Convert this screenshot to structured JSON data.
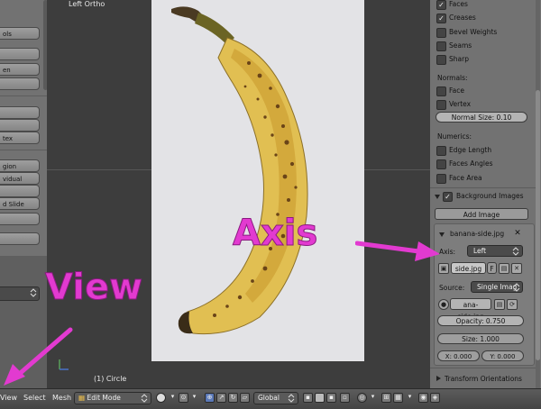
{
  "viewport": {
    "title": "Left Ortho",
    "object_label": "(1) Circle"
  },
  "left_panel": {
    "buttons": [
      "ols",
      "",
      "en",
      "",
      "",
      "tex",
      "gion",
      "vidual",
      "",
      "d Slide",
      "",
      ""
    ]
  },
  "right_panel": {
    "display_checks": [
      {
        "label": "Faces",
        "checked": true
      },
      {
        "label": "Creases",
        "checked": true
      },
      {
        "label": "Bevel Weights",
        "checked": false
      },
      {
        "label": "Seams",
        "checked": false
      },
      {
        "label": "Sharp",
        "checked": false
      }
    ],
    "normals_heading": "Normals:",
    "normals_checks": [
      {
        "label": "Face",
        "checked": false
      },
      {
        "label": "Vertex",
        "checked": false
      }
    ],
    "normal_size": "Normal Size: 0.10",
    "numerics_heading": "Numerics:",
    "numerics_checks": [
      {
        "label": "Edge Length",
        "checked": false
      },
      {
        "label": "Faces Angles",
        "checked": false
      },
      {
        "label": "Face Area",
        "checked": false
      }
    ],
    "background_images": {
      "section_label": "Background Images",
      "enabled": true,
      "add_image_label": "Add Image",
      "image_name": "banana-side.jpg",
      "axis_label": "Axis:",
      "axis_value": "Left",
      "file_field": "side.jpg",
      "file_flag": "F",
      "source_label": "Source:",
      "source_value": "Single Imag",
      "source_file": "ana-side.jpg",
      "opacity": "Opacity: 0.750",
      "size": "Size: 1.000",
      "x_offset": "X: 0.000",
      "y_offset": "Y: 0.000"
    },
    "transform_orientations_label": "Transform Orientations"
  },
  "header": {
    "menus": [
      "View",
      "Select",
      "Mesh"
    ],
    "mode": "Edit Mode",
    "orientation": "Global"
  },
  "annotations": {
    "view": "View",
    "axis": "Axis",
    "color": "#e23ad0"
  },
  "icons": {
    "checkmark": "check-icon",
    "close": "close-icon",
    "folder": "folder-icon",
    "refresh": "refresh-icon"
  }
}
